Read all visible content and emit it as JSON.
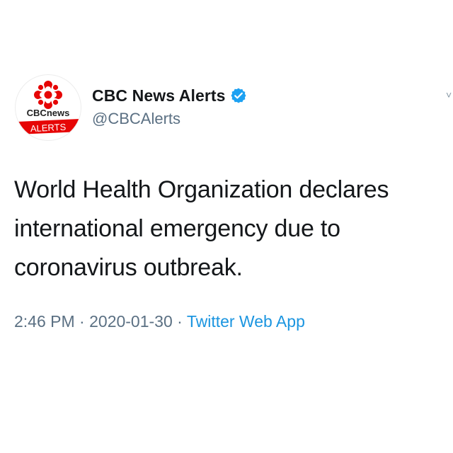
{
  "account": {
    "display_name": "CBC News Alerts",
    "handle": "@CBCAlerts",
    "verified": true,
    "avatar": {
      "brand_text": "CBCnews",
      "badge_text": "ALERTS",
      "brand_color": "#e60505"
    }
  },
  "tweet": {
    "text_lines": [
      "World Health Organization declares",
      "international emergency due to",
      "coronavirus outbreak."
    ],
    "time": "2:46 PM",
    "separator": "·",
    "date": "2020-01-30",
    "source": "Twitter Web App"
  },
  "icons": {
    "verified": "verified-badge-icon",
    "menu": "chevron-down-icon"
  },
  "colors": {
    "link": "#1b95e0",
    "verified": "#1da1f2",
    "secondary_text": "#5b7083"
  }
}
